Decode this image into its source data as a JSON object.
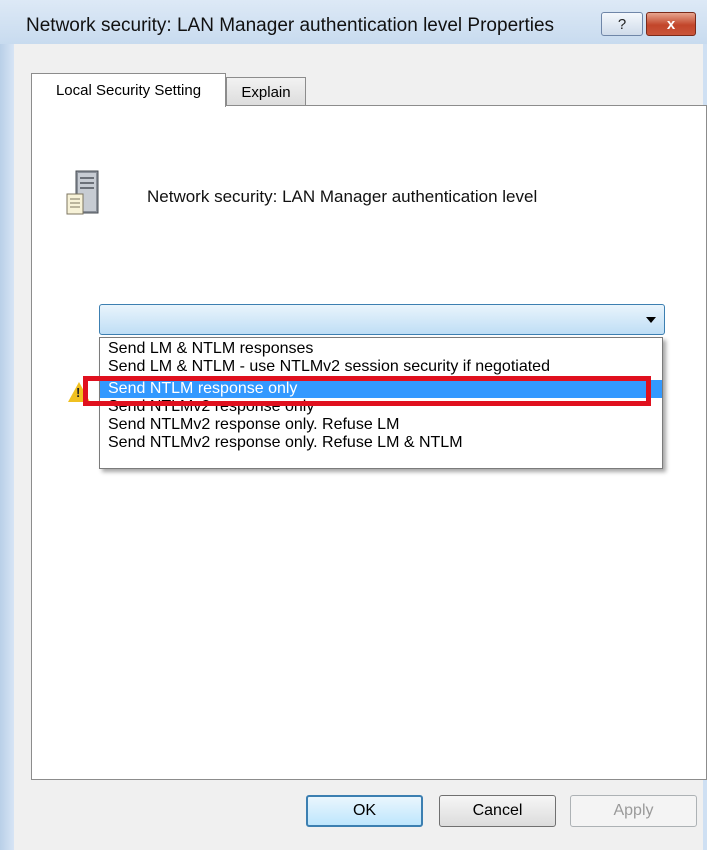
{
  "window": {
    "title": "Network security: LAN Manager authentication level Properties",
    "help_label": "?",
    "close_label": "x"
  },
  "tabs": [
    {
      "label": "Local Security Setting",
      "active": true
    },
    {
      "label": "Explain",
      "active": false
    }
  ],
  "policy": {
    "icon": "server-icon",
    "title": "Network security: LAN Manager authentication level"
  },
  "dropdown": {
    "current_value": "",
    "options": [
      {
        "label": "Send LM & NTLM responses"
      },
      {
        "label": "Send LM & NTLM - use NTLMv2 session security if negotiated"
      },
      {
        "label": "Send NTLM response only",
        "selected": true
      },
      {
        "label": "Send NTLMv2 response only"
      },
      {
        "label": "Send NTLMv2 response only. Refuse LM"
      },
      {
        "label": "Send NTLMv2 response only. Refuse LM & NTLM"
      }
    ]
  },
  "warning": {
    "icon": "warning-icon",
    "mark": "!"
  },
  "buttons": {
    "ok": "OK",
    "cancel": "Cancel",
    "apply": "Apply"
  },
  "colors": {
    "selection": "#3399ff",
    "annotation_highlight": "#e0101e"
  }
}
